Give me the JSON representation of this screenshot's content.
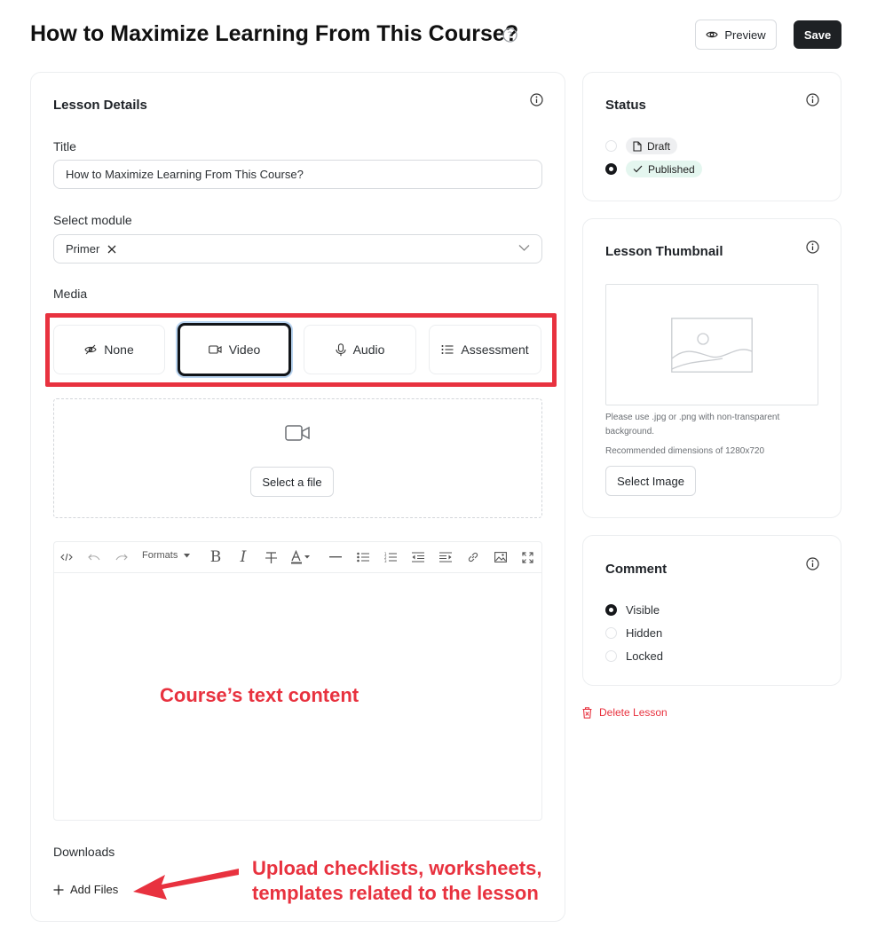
{
  "page": {
    "title": "How to Maximize Learning From This Course?",
    "preview_label": "Preview",
    "save_label": "Save"
  },
  "lesson_details": {
    "heading": "Lesson Details",
    "title_label": "Title",
    "title_value": "How to Maximize Learning From This Course?",
    "module_label": "Select module",
    "module_value": "Primer",
    "media_label": "Media",
    "media_options": [
      {
        "label": "None",
        "icon": "eye-off-icon"
      },
      {
        "label": "Video",
        "icon": "video-icon"
      },
      {
        "label": "Audio",
        "icon": "microphone-icon"
      },
      {
        "label": "Assessment",
        "icon": "list-icon"
      }
    ],
    "media_selected": "Video",
    "select_file_label": "Select a file",
    "editor": {
      "formats_label": "Formats",
      "tools": [
        "code-view-icon",
        "undo-icon",
        "redo-icon",
        "bold-icon",
        "italic-icon",
        "strikethrough-icon",
        "text-color-icon",
        "horizontal-rule-icon",
        "bullet-list-icon",
        "numbered-list-icon",
        "outdent-icon",
        "indent-icon",
        "link-icon",
        "image-icon",
        "fullscreen-icon"
      ]
    },
    "downloads_label": "Downloads",
    "add_files_label": "Add Files"
  },
  "status": {
    "heading": "Status",
    "options": [
      {
        "label": "Draft",
        "selected": false
      },
      {
        "label": "Published",
        "selected": true
      }
    ]
  },
  "thumbnail": {
    "heading": "Lesson Thumbnail",
    "hint": "Please use .jpg or .png with non-transparent background.",
    "dimensions": "Recommended dimensions of 1280x720",
    "select_image_label": "Select Image"
  },
  "comment": {
    "heading": "Comment",
    "options": [
      {
        "label": "Visible",
        "selected": true
      },
      {
        "label": "Hidden",
        "selected": false
      },
      {
        "label": "Locked",
        "selected": false
      }
    ]
  },
  "delete_label": "Delete Lesson",
  "annotations": {
    "text_content": "Course’s text content",
    "upload_line1": "Upload checklists, worksheets,",
    "upload_line2": "templates related to the lesson"
  },
  "colors": {
    "accent_red": "#e8323f",
    "dark_button": "#1e2124",
    "published_green": "#e4f6ef"
  }
}
